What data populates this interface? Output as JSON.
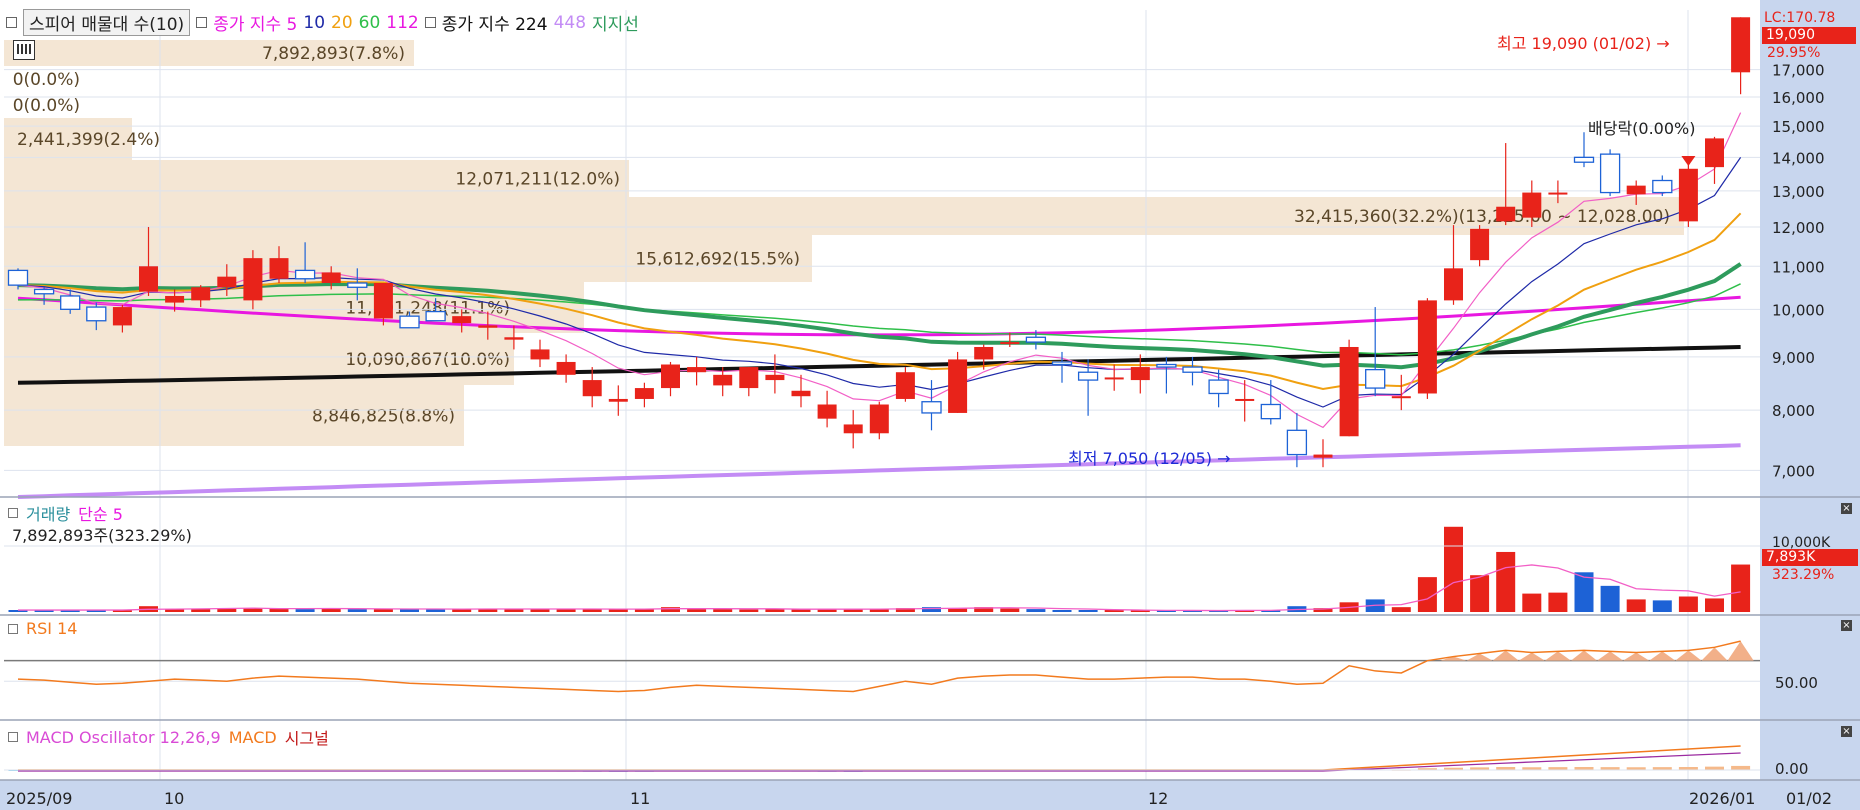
{
  "legend": {
    "indicator_button": "스피어 매물대 수(10)",
    "ma_label": "종가 지수 5",
    "ma_10": "10",
    "ma_20": "20",
    "ma_60": "60",
    "ma_112": "112",
    "ma_224_label": "종가 지수 224",
    "ma_448": "448",
    "support_label": "지지선"
  },
  "colors": {
    "up": "#e8231a",
    "down": "#1d62d6",
    "ma5": "#f25fc6",
    "ma10": "#1f2aa8",
    "ma20": "#f0a010",
    "ma60": "#2fbf4a",
    "ma112": "#e818e0",
    "ma224": "#111111",
    "ma448": "#c38cf5",
    "support": "#2e9b5c",
    "volume_profile": "#f4e6d4",
    "axis_bg": "#c8d6ee",
    "rsi": "#f27a1e",
    "macd_osc": "#d94bd6"
  },
  "volume_profile": [
    {
      "label": "7,892,893(7.8%)"
    },
    {
      "label": "0(0.0%)"
    },
    {
      "label": "0(0.0%)"
    },
    {
      "label": "2,441,399(2.4%)"
    },
    {
      "label": "12,071,211(12.0%)"
    },
    {
      "label": "32,415,360(32.2%)(13,225.00 ~ 12,028.00)"
    },
    {
      "label": "15,612,692(15.5%)"
    },
    {
      "label": "11,101,248(11.1%)"
    },
    {
      "label": "10,090,867(10.0%)"
    },
    {
      "label": "8,846,825(8.8%)"
    }
  ],
  "annotations": {
    "high": "최고 19,090 (01/02)",
    "low": "최저 7,050 (12/05)",
    "dividend": "배당락(0.00%)"
  },
  "price_axis": {
    "lc": "LC:170.78",
    "current": "19,090",
    "change": "29.95%",
    "ticks": [
      "17,000",
      "16,000",
      "15,000",
      "14,000",
      "13,000",
      "12,000",
      "11,000",
      "10,000",
      "9,000",
      "8,000",
      "7,000"
    ]
  },
  "volume_panel": {
    "title": "거래량",
    "ma_label": "단순 5",
    "info": "7,892,893주(323.29%)",
    "axis_tick": "10,000K",
    "current": "7,893K",
    "pct": "323.29%"
  },
  "rsi_panel": {
    "title": "RSI 14",
    "axis_tick": "50.00"
  },
  "macd_panel": {
    "title": "MACD Oscillator 12,26,9",
    "macd_label": "MACD",
    "signal_label": "시그널",
    "axis_tick": "0.00"
  },
  "date_axis": {
    "labels": [
      "2025/09",
      "10",
      "11",
      "12",
      "2026/01"
    ],
    "right_label": "01/02"
  },
  "chart_data": {
    "type": "candlestick",
    "ylim": [
      6600,
      19400
    ],
    "scale": "log",
    "candles": [
      [
        10900,
        10950,
        10450,
        10550
      ],
      [
        10450,
        10500,
        10100,
        10350
      ],
      [
        10300,
        10450,
        9900,
        10000
      ],
      [
        10050,
        10150,
        9550,
        9750
      ],
      [
        9650,
        10100,
        9500,
        10050
      ],
      [
        10400,
        12000,
        10300,
        11000
      ],
      [
        10150,
        10450,
        9950,
        10300
      ],
      [
        10200,
        10550,
        10050,
        10500
      ],
      [
        10500,
        11050,
        10300,
        10750
      ],
      [
        10200,
        11400,
        10000,
        11200
      ],
      [
        10700,
        11500,
        10600,
        11200
      ],
      [
        10900,
        11600,
        10600,
        10700
      ],
      [
        10600,
        11000,
        10450,
        10850
      ],
      [
        10600,
        10950,
        10200,
        10500
      ],
      [
        9800,
        10600,
        9650,
        10600
      ],
      [
        9850,
        9950,
        9600,
        9600
      ],
      [
        9950,
        10250,
        9750,
        9750
      ],
      [
        9700,
        10000,
        9500,
        9850
      ],
      [
        9600,
        9950,
        9350,
        9650
      ],
      [
        9350,
        9650,
        9150,
        9400
      ],
      [
        8950,
        9350,
        8800,
        9150
      ],
      [
        8650,
        9050,
        8500,
        8900
      ],
      [
        8250,
        8800,
        8050,
        8550
      ],
      [
        8150,
        8450,
        7900,
        8200
      ],
      [
        8200,
        8500,
        8050,
        8400
      ],
      [
        8400,
        8900,
        8250,
        8850
      ],
      [
        8700,
        9000,
        8450,
        8800
      ],
      [
        8450,
        8800,
        8250,
        8650
      ],
      [
        8400,
        8800,
        8250,
        8800
      ],
      [
        8550,
        9050,
        8300,
        8650
      ],
      [
        8250,
        8650,
        8050,
        8350
      ],
      [
        7850,
        8350,
        7700,
        8100
      ],
      [
        7600,
        8000,
        7350,
        7750
      ],
      [
        7600,
        8150,
        7500,
        8100
      ],
      [
        8200,
        8800,
        8150,
        8700
      ],
      [
        8150,
        8550,
        7650,
        7950
      ],
      [
        7950,
        9100,
        7950,
        8950
      ],
      [
        8950,
        9250,
        8750,
        9200
      ],
      [
        9300,
        9500,
        9200,
        9300
      ],
      [
        9400,
        9550,
        9150,
        9300
      ],
      [
        8900,
        9100,
        8500,
        8850
      ],
      [
        8700,
        8950,
        7900,
        8550
      ],
      [
        8600,
        8850,
        8350,
        8600
      ],
      [
        8550,
        9050,
        8300,
        8800
      ],
      [
        8850,
        9000,
        8300,
        8800
      ],
      [
        8800,
        9000,
        8450,
        8700
      ],
      [
        8550,
        8750,
        8050,
        8300
      ],
      [
        8200,
        8550,
        7800,
        8200
      ],
      [
        8100,
        8550,
        7750,
        7850
      ],
      [
        7650,
        7950,
        7050,
        7250
      ],
      [
        7200,
        7500,
        7050,
        7250
      ],
      [
        7550,
        9350,
        7550,
        9200
      ],
      [
        8750,
        10050,
        8250,
        8400
      ],
      [
        8250,
        8650,
        8000,
        8250
      ],
      [
        8300,
        10250,
        8200,
        10200
      ],
      [
        10200,
        12050,
        10100,
        10950
      ],
      [
        11150,
        12050,
        11000,
        11950
      ],
      [
        12150,
        14450,
        12050,
        12550
      ],
      [
        12250,
        13300,
        12000,
        12950
      ],
      [
        12900,
        13300,
        12650,
        12950
      ],
      [
        14000,
        14800,
        13700,
        13850
      ],
      [
        14100,
        14250,
        12850,
        12950
      ],
      [
        12900,
        13300,
        12600,
        13150
      ],
      [
        13300,
        13450,
        12850,
        12950
      ],
      [
        12150,
        13850,
        12000,
        13650
      ],
      [
        13700,
        14650,
        13200,
        14600
      ],
      [
        16900,
        19090,
        16100,
        19090
      ]
    ],
    "series": [
      {
        "name": "종가 지수 224",
        "start": 8500,
        "end": 9200
      },
      {
        "name": "448",
        "start": 6600,
        "end": 7400
      },
      {
        "name": "112",
        "start": 10250,
        "end": 10250
      }
    ],
    "annotation_values": {
      "high": 19090,
      "low": 7050,
      "current": 19090
    }
  }
}
